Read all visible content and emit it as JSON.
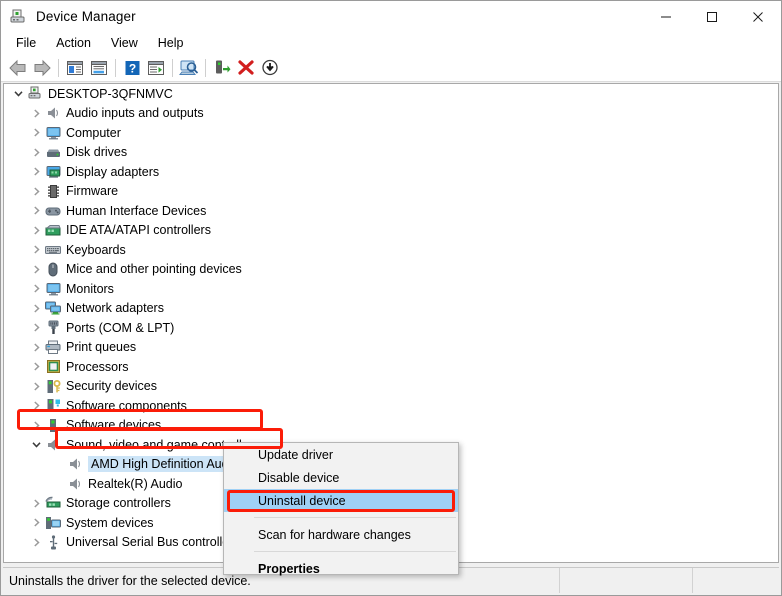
{
  "window": {
    "title": "Device Manager",
    "icon": "device-manager-icon",
    "controls": [
      {
        "name": "minimize",
        "glyph": "minimize-icon"
      },
      {
        "name": "maximize",
        "glyph": "maximize-icon"
      },
      {
        "name": "close",
        "glyph": "close-icon"
      }
    ]
  },
  "menubar": {
    "items": [
      {
        "label": "File"
      },
      {
        "label": "Action"
      },
      {
        "label": "View"
      },
      {
        "label": "Help"
      }
    ]
  },
  "toolbar": {
    "buttons": [
      {
        "name": "back-icon"
      },
      {
        "name": "forward-icon"
      },
      {
        "name": "separator"
      },
      {
        "name": "show-hide-console-tree-icon"
      },
      {
        "name": "properties-icon"
      },
      {
        "name": "separator"
      },
      {
        "name": "help-icon"
      },
      {
        "name": "show-hide-action-pane-icon"
      },
      {
        "name": "separator"
      },
      {
        "name": "scan-for-hardware-changes-icon"
      },
      {
        "name": "separator"
      },
      {
        "name": "update-driver-icon"
      },
      {
        "name": "uninstall-device-icon"
      },
      {
        "name": "disable-device-icon"
      }
    ]
  },
  "tree": {
    "root": {
      "label": "DESKTOP-3QFNMVC",
      "icon": "computer-root-icon",
      "expanded": true
    },
    "items": [
      {
        "label": "Audio inputs and outputs",
        "icon": "speaker-icon",
        "indent": 1,
        "expandable": true
      },
      {
        "label": "Computer",
        "icon": "monitor-icon",
        "indent": 1,
        "expandable": true
      },
      {
        "label": "Disk drives",
        "icon": "disk-icon",
        "indent": 1,
        "expandable": true
      },
      {
        "label": "Display adapters",
        "icon": "display-card-icon",
        "indent": 1,
        "expandable": true
      },
      {
        "label": "Firmware",
        "icon": "chip-icon",
        "indent": 1,
        "expandable": true
      },
      {
        "label": "Human Interface Devices",
        "icon": "gamepad-icon",
        "indent": 1,
        "expandable": true
      },
      {
        "label": "IDE ATA/ATAPI controllers",
        "icon": "ide-card-icon",
        "indent": 1,
        "expandable": true
      },
      {
        "label": "Keyboards",
        "icon": "keyboard-icon",
        "indent": 1,
        "expandable": true
      },
      {
        "label": "Mice and other pointing devices",
        "icon": "mouse-icon",
        "indent": 1,
        "expandable": true
      },
      {
        "label": "Monitors",
        "icon": "monitor-icon",
        "indent": 1,
        "expandable": true
      },
      {
        "label": "Network adapters",
        "icon": "network-icon",
        "indent": 1,
        "expandable": true
      },
      {
        "label": "Ports (COM & LPT)",
        "icon": "port-icon",
        "indent": 1,
        "expandable": true
      },
      {
        "label": "Print queues",
        "icon": "printer-icon",
        "indent": 1,
        "expandable": true
      },
      {
        "label": "Processors",
        "icon": "processor-icon",
        "indent": 1,
        "expandable": true
      },
      {
        "label": "Security devices",
        "icon": "security-icon",
        "indent": 1,
        "expandable": true
      },
      {
        "label": "Software components",
        "icon": "software-comp-icon",
        "indent": 1,
        "expandable": true
      },
      {
        "label": "Software devices",
        "icon": "software-dev-icon",
        "indent": 1,
        "expandable": true
      },
      {
        "label": "Sound, video and game controllers",
        "icon": "speaker-icon",
        "indent": 1,
        "expanded": true,
        "highlighted": true
      },
      {
        "label": "AMD High Definition Audio Device",
        "icon": "speaker-icon",
        "indent": 2,
        "selected": true,
        "highlighted": true
      },
      {
        "label": "Realtek(R) Audio",
        "icon": "speaker-icon",
        "indent": 2
      },
      {
        "label": "Storage controllers",
        "icon": "storage-icon",
        "indent": 1,
        "expandable": true
      },
      {
        "label": "System devices",
        "icon": "system-icon",
        "indent": 1,
        "expandable": true
      },
      {
        "label": "Universal Serial Bus controllers",
        "icon": "usb-icon",
        "indent": 1,
        "expandable": true
      }
    ]
  },
  "context_menu": {
    "items": [
      {
        "label": "Update driver",
        "type": "item"
      },
      {
        "label": "Disable device",
        "type": "item"
      },
      {
        "label": "Uninstall device",
        "type": "item",
        "highlighted": true
      },
      {
        "type": "separator"
      },
      {
        "label": "Scan for hardware changes",
        "type": "item"
      },
      {
        "type": "separator"
      },
      {
        "label": "Properties",
        "type": "item",
        "bold": true
      }
    ]
  },
  "statusbar": {
    "text": "Uninstalls the driver for the selected device."
  },
  "annotations": {
    "highlight_color": "#fb1c08",
    "boxes": [
      {
        "name": "sound-video-game-controllers-callout"
      },
      {
        "name": "amd-high-definition-audio-device-callout"
      },
      {
        "name": "uninstall-device-callout"
      }
    ]
  },
  "colors": {
    "selection_blue": "#cce4f7",
    "menu_highlight_blue": "#9fd0f5",
    "annotation_red": "#fb1c08"
  }
}
